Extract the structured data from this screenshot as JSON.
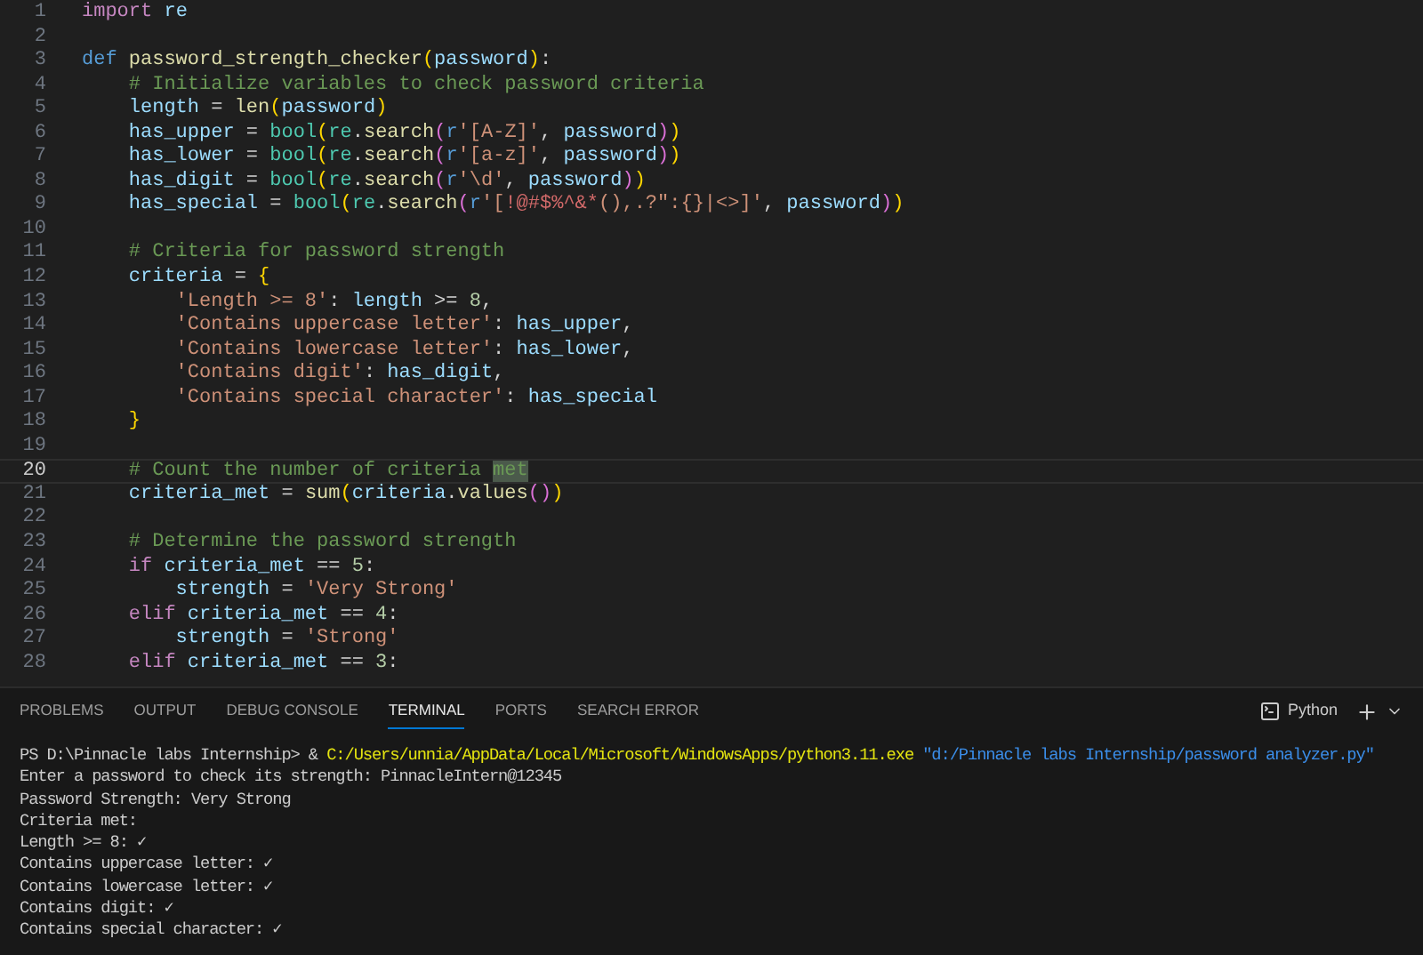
{
  "editor": {
    "lines": [
      {
        "number": "1",
        "current": false,
        "tokens": [
          {
            "kind": "keyword",
            "text": "import "
          },
          {
            "kind": "variable",
            "text": "re"
          }
        ]
      },
      {
        "number": "2",
        "current": false
      },
      {
        "number": "3",
        "current": false,
        "tokens": [
          {
            "kind": "storage",
            "text": "def "
          },
          {
            "kind": "function",
            "text": "password_strength_checker"
          },
          {
            "kind": "bracket1",
            "text": "("
          },
          {
            "kind": "variable",
            "text": "password"
          },
          {
            "kind": "bracket1",
            "text": ")"
          },
          {
            "kind": "plain",
            "text": ":"
          }
        ]
      },
      {
        "number": "4",
        "current": false,
        "tokens": [
          {
            "kind": "comment",
            "text": "    # Initialize variables to check password criteria"
          }
        ]
      },
      {
        "number": "5",
        "current": false,
        "tokens": [
          {
            "kind": "variable",
            "text": "    length"
          },
          {
            "kind": "plain",
            "text": " = "
          },
          {
            "kind": "function",
            "text": "len"
          },
          {
            "kind": "bracket1",
            "text": "("
          },
          {
            "kind": "variable",
            "text": "password"
          },
          {
            "kind": "bracket1",
            "text": ")"
          }
        ]
      },
      {
        "number": "6",
        "current": false,
        "tokens": [
          {
            "kind": "variable",
            "text": "    has_upper"
          },
          {
            "kind": "plain",
            "text": " = "
          },
          {
            "kind": "type",
            "text": "bool"
          },
          {
            "kind": "bracket1",
            "text": "("
          },
          {
            "kind": "type",
            "text": "re"
          },
          {
            "kind": "plain",
            "text": "."
          },
          {
            "kind": "function",
            "text": "search"
          },
          {
            "kind": "bracket2",
            "text": "("
          },
          {
            "kind": "storage",
            "text": "r"
          },
          {
            "kind": "string",
            "text": "'[A-Z]'"
          },
          {
            "kind": "plain",
            "text": ", "
          },
          {
            "kind": "variable",
            "text": "password"
          },
          {
            "kind": "bracket2",
            "text": ")"
          },
          {
            "kind": "bracket1",
            "text": ")"
          }
        ]
      },
      {
        "number": "7",
        "current": false,
        "tokens": [
          {
            "kind": "variable",
            "text": "    has_lower"
          },
          {
            "kind": "plain",
            "text": " = "
          },
          {
            "kind": "type",
            "text": "bool"
          },
          {
            "kind": "bracket1",
            "text": "("
          },
          {
            "kind": "type",
            "text": "re"
          },
          {
            "kind": "plain",
            "text": "."
          },
          {
            "kind": "function",
            "text": "search"
          },
          {
            "kind": "bracket2",
            "text": "("
          },
          {
            "kind": "storage",
            "text": "r"
          },
          {
            "kind": "string",
            "text": "'[a-z]'"
          },
          {
            "kind": "plain",
            "text": ", "
          },
          {
            "kind": "variable",
            "text": "password"
          },
          {
            "kind": "bracket2",
            "text": ")"
          },
          {
            "kind": "bracket1",
            "text": ")"
          }
        ]
      },
      {
        "number": "8",
        "current": false,
        "tokens": [
          {
            "kind": "variable",
            "text": "    has_digit"
          },
          {
            "kind": "plain",
            "text": " = "
          },
          {
            "kind": "type",
            "text": "bool"
          },
          {
            "kind": "bracket1",
            "text": "("
          },
          {
            "kind": "type",
            "text": "re"
          },
          {
            "kind": "plain",
            "text": "."
          },
          {
            "kind": "function",
            "text": "search"
          },
          {
            "kind": "bracket2",
            "text": "("
          },
          {
            "kind": "storage",
            "text": "r"
          },
          {
            "kind": "string",
            "text": "'\\d'"
          },
          {
            "kind": "plain",
            "text": ", "
          },
          {
            "kind": "variable",
            "text": "password"
          },
          {
            "kind": "bracket2",
            "text": ")"
          },
          {
            "kind": "bracket1",
            "text": ")"
          }
        ]
      },
      {
        "number": "9",
        "current": false,
        "tokens": [
          {
            "kind": "variable",
            "text": "    has_special"
          },
          {
            "kind": "plain",
            "text": " = "
          },
          {
            "kind": "type",
            "text": "bool"
          },
          {
            "kind": "bracket1",
            "text": "("
          },
          {
            "kind": "type",
            "text": "re"
          },
          {
            "kind": "plain",
            "text": "."
          },
          {
            "kind": "function",
            "text": "search"
          },
          {
            "kind": "bracket2",
            "text": "("
          },
          {
            "kind": "storage",
            "text": "r"
          },
          {
            "kind": "string",
            "text": "'["
          },
          {
            "kind": "regex",
            "text": "!@#$%^&*"
          },
          {
            "kind": "string",
            "text": "(),.?\":{}|<>]'"
          },
          {
            "kind": "plain",
            "text": ", "
          },
          {
            "kind": "variable",
            "text": "password"
          },
          {
            "kind": "bracket2",
            "text": ")"
          },
          {
            "kind": "bracket1",
            "text": ")"
          }
        ]
      },
      {
        "number": "10",
        "current": false
      },
      {
        "number": "11",
        "current": false,
        "tokens": [
          {
            "kind": "comment",
            "text": "    # Criteria for password strength"
          }
        ]
      },
      {
        "number": "12",
        "current": false,
        "tokens": [
          {
            "kind": "variable",
            "text": "    criteria"
          },
          {
            "kind": "plain",
            "text": " = "
          },
          {
            "kind": "bracket1",
            "text": "{"
          }
        ]
      },
      {
        "number": "13",
        "current": false,
        "tokens": [
          {
            "kind": "string",
            "text": "        'Length >= 8'"
          },
          {
            "kind": "plain",
            "text": ": "
          },
          {
            "kind": "variable",
            "text": "length"
          },
          {
            "kind": "plain",
            "text": " >= "
          },
          {
            "kind": "number",
            "text": "8"
          },
          {
            "kind": "plain",
            "text": ","
          }
        ]
      },
      {
        "number": "14",
        "current": false,
        "tokens": [
          {
            "kind": "string",
            "text": "        'Contains uppercase letter'"
          },
          {
            "kind": "plain",
            "text": ": "
          },
          {
            "kind": "variable",
            "text": "has_upper"
          },
          {
            "kind": "plain",
            "text": ","
          }
        ]
      },
      {
        "number": "15",
        "current": false,
        "tokens": [
          {
            "kind": "string",
            "text": "        'Contains lowercase letter'"
          },
          {
            "kind": "plain",
            "text": ": "
          },
          {
            "kind": "variable",
            "text": "has_lower"
          },
          {
            "kind": "plain",
            "text": ","
          }
        ]
      },
      {
        "number": "16",
        "current": false,
        "tokens": [
          {
            "kind": "string",
            "text": "        'Contains digit'"
          },
          {
            "kind": "plain",
            "text": ": "
          },
          {
            "kind": "variable",
            "text": "has_digit"
          },
          {
            "kind": "plain",
            "text": ","
          }
        ]
      },
      {
        "number": "17",
        "current": false,
        "tokens": [
          {
            "kind": "string",
            "text": "        'Contains special character'"
          },
          {
            "kind": "plain",
            "text": ": "
          },
          {
            "kind": "variable",
            "text": "has_special"
          }
        ]
      },
      {
        "number": "18",
        "current": false,
        "tokens": [
          {
            "kind": "bracket1",
            "text": "    }"
          }
        ]
      },
      {
        "number": "19",
        "current": false
      },
      {
        "number": "20",
        "current": true,
        "tokens": [
          {
            "kind": "comment",
            "text": "    # Count the number of criteria "
          },
          {
            "kind": "match",
            "text": "met"
          }
        ]
      },
      {
        "number": "21",
        "current": false,
        "tokens": [
          {
            "kind": "variable",
            "text": "    criteria_met"
          },
          {
            "kind": "plain",
            "text": " = "
          },
          {
            "kind": "function",
            "text": "sum"
          },
          {
            "kind": "bracket1",
            "text": "("
          },
          {
            "kind": "variable",
            "text": "criteria"
          },
          {
            "kind": "plain",
            "text": "."
          },
          {
            "kind": "function",
            "text": "values"
          },
          {
            "kind": "bracket2",
            "text": "()"
          },
          {
            "kind": "bracket1",
            "text": ")"
          }
        ]
      },
      {
        "number": "22",
        "current": false
      },
      {
        "number": "23",
        "current": false,
        "tokens": [
          {
            "kind": "comment",
            "text": "    # Determine the password strength"
          }
        ]
      },
      {
        "number": "24",
        "current": false,
        "tokens": [
          {
            "kind": "keyword",
            "text": "    if "
          },
          {
            "kind": "variable",
            "text": "criteria_met"
          },
          {
            "kind": "plain",
            "text": " == "
          },
          {
            "kind": "number",
            "text": "5"
          },
          {
            "kind": "plain",
            "text": ":"
          }
        ]
      },
      {
        "number": "25",
        "current": false,
        "tokens": [
          {
            "kind": "variable",
            "text": "        strength"
          },
          {
            "kind": "plain",
            "text": " = "
          },
          {
            "kind": "string",
            "text": "'Very Strong'"
          }
        ]
      },
      {
        "number": "26",
        "current": false,
        "tokens": [
          {
            "kind": "keyword",
            "text": "    elif "
          },
          {
            "kind": "variable",
            "text": "criteria_met"
          },
          {
            "kind": "plain",
            "text": " == "
          },
          {
            "kind": "number",
            "text": "4"
          },
          {
            "kind": "plain",
            "text": ":"
          }
        ]
      },
      {
        "number": "27",
        "current": false,
        "tokens": [
          {
            "kind": "variable",
            "text": "        strength"
          },
          {
            "kind": "plain",
            "text": " = "
          },
          {
            "kind": "string",
            "text": "'Strong'"
          }
        ]
      },
      {
        "number": "28",
        "current": false,
        "tokens": [
          {
            "kind": "keyword",
            "text": "    elif "
          },
          {
            "kind": "variable",
            "text": "criteria_met"
          },
          {
            "kind": "plain",
            "text": " == "
          },
          {
            "kind": "number",
            "text": "3"
          },
          {
            "kind": "plain",
            "text": ":"
          }
        ]
      }
    ]
  },
  "panel": {
    "tabs": [
      {
        "label": "PROBLEMS",
        "selected": false
      },
      {
        "label": "OUTPUT",
        "selected": false
      },
      {
        "label": "DEBUG CONSOLE",
        "selected": false
      },
      {
        "label": "TERMINAL",
        "selected": true
      },
      {
        "label": "PORTS",
        "selected": false
      },
      {
        "label": "SEARCH ERROR",
        "selected": false
      }
    ],
    "terminal_profile": "Python",
    "terminal_lines": [
      [
        {
          "kind": "plain",
          "text": "PS D:\\Pinnacle labs Internship> & "
        },
        {
          "kind": "path",
          "text": "C:/Users/unnia/AppData/Local/Microsoft/WindowsApps/python3.11.exe"
        },
        {
          "kind": "arg",
          "text": " \"d:/Pinnacle labs Internship/password analyzer.py\""
        }
      ],
      [
        {
          "kind": "plain",
          "text": "Enter a password to check its strength: PinnacleIntern@12345"
        }
      ],
      [
        {
          "kind": "plain",
          "text": "Password Strength: Very Strong"
        }
      ],
      [
        {
          "kind": "plain",
          "text": "Criteria met:"
        }
      ],
      [
        {
          "kind": "plain",
          "text": "Length >= 8: ✓"
        }
      ],
      [
        {
          "kind": "plain",
          "text": "Contains uppercase letter: ✓"
        }
      ],
      [
        {
          "kind": "plain",
          "text": "Contains lowercase letter: ✓"
        }
      ],
      [
        {
          "kind": "plain",
          "text": "Contains digit: ✓"
        }
      ],
      [
        {
          "kind": "plain",
          "text": "Contains special character: ✓"
        }
      ]
    ]
  }
}
